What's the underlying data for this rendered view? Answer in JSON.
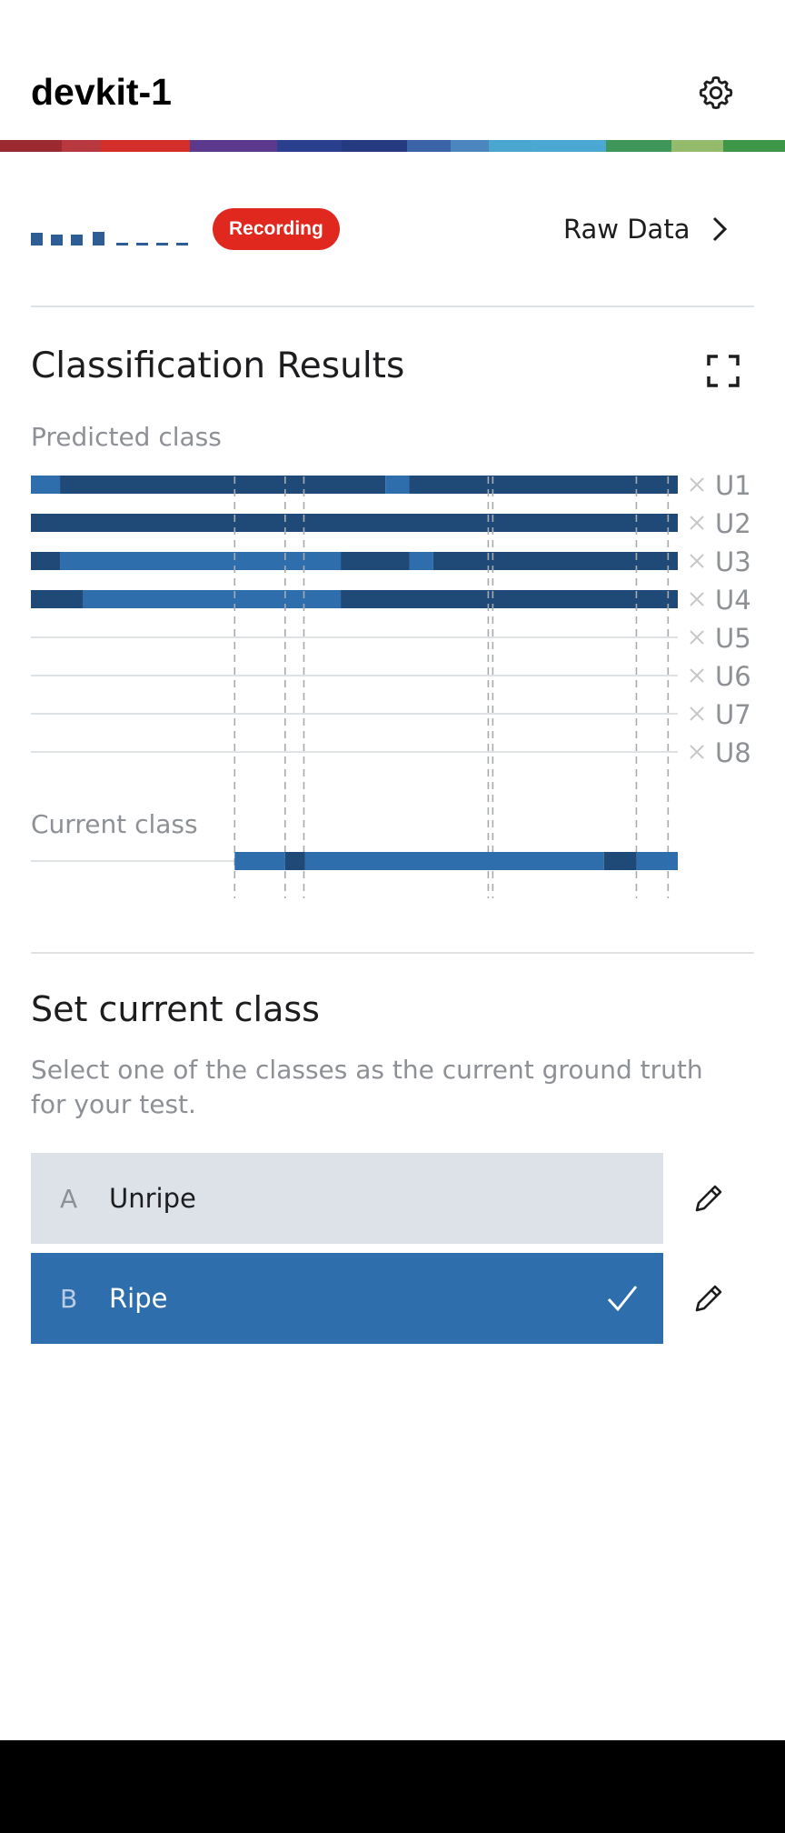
{
  "header": {
    "title": "devkit-1",
    "settings_icon": "gear-icon"
  },
  "stripe_colors": [
    "#9b2a30",
    "#b8383f",
    "#d42e2a",
    "#d42e2a",
    "#5b3a8e",
    "#2b3f8f",
    "#253a80",
    "#3a63a8",
    "#4c86be",
    "#4ba6cf",
    "#4aa8d3",
    "#3e9658",
    "#94ba6c",
    "#3e9649"
  ],
  "toolbar": {
    "recording_label": "Recording",
    "raw_data_label": "Raw Data",
    "signal_icon": "signal-strength-icon",
    "chevron_icon": "chevron-right-icon"
  },
  "classification": {
    "title": "Classification Results",
    "expand_icon": "expand-icon",
    "predicted_label": "Predicted class",
    "current_label": "Current class",
    "rows": [
      "U1",
      "U2",
      "U3",
      "U4",
      "U5",
      "U6",
      "U7",
      "U8"
    ]
  },
  "chart_data": {
    "type": "timeline",
    "rows": [
      {
        "label": "U1",
        "segments": [
          [
            "light",
            0,
            0.045
          ],
          [
            "dark",
            0.045,
            0.548
          ],
          [
            "light",
            0.548,
            0.585
          ],
          [
            "dark",
            0.585,
            1.0
          ]
        ]
      },
      {
        "label": "U2",
        "segments": [
          [
            "dark",
            0,
            1.0
          ]
        ]
      },
      {
        "label": "U3",
        "segments": [
          [
            "dark",
            0,
            0.045
          ],
          [
            "light",
            0.045,
            0.479
          ],
          [
            "dark",
            0.479,
            0.585
          ],
          [
            "light",
            0.585,
            0.622
          ],
          [
            "dark",
            0.622,
            1.0
          ]
        ]
      },
      {
        "label": "U4",
        "segments": [
          [
            "dark",
            0,
            0.081
          ],
          [
            "light",
            0.081,
            0.479
          ],
          [
            "dark",
            0.479,
            1.0
          ]
        ]
      },
      {
        "label": "U5",
        "segments": []
      },
      {
        "label": "U6",
        "segments": []
      },
      {
        "label": "U7",
        "segments": []
      },
      {
        "label": "U8",
        "segments": []
      }
    ],
    "current_class": [
      [
        "light",
        0.315,
        0.393
      ],
      [
        "dark",
        0.393,
        0.424
      ],
      [
        "light",
        0.424,
        0.886
      ],
      [
        "dark",
        0.886,
        0.936
      ],
      [
        "light",
        0.936,
        1.0
      ]
    ],
    "markers": [
      0.315,
      0.393,
      0.422,
      0.707,
      0.714,
      0.936,
      0.985
    ]
  },
  "set_class": {
    "title": "Set current class",
    "description": "Select one of the classes as the current ground truth for your test.",
    "items": [
      {
        "letter": "A",
        "name": "Unripe",
        "selected": false
      },
      {
        "letter": "B",
        "name": "Ripe",
        "selected": true
      }
    ],
    "check_icon": "checkmark-icon",
    "edit_icon": "pencil-icon"
  }
}
